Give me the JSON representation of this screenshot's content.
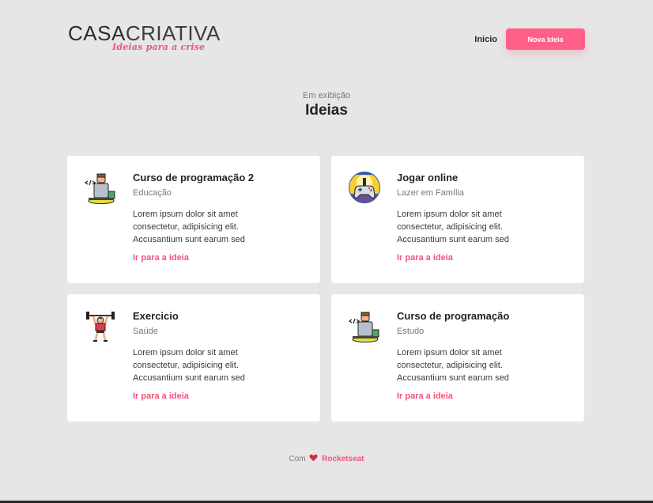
{
  "logo": {
    "part1": "CASA",
    "part2": "CRIATIVA",
    "tagline": "Ideias para a crise"
  },
  "nav": {
    "home_label": "Inicio",
    "new_idea_label": "Nova Ideia"
  },
  "section": {
    "subtitle": "Em exibição",
    "title": "Ideias"
  },
  "cards": [
    {
      "icon": "programmer-icon",
      "title": "Curso de programação 2",
      "category": "Educação",
      "description": "Lorem ipsum dolor sit amet consectetur, adipisicing elit. Accusantium sunt earum sed",
      "link": "Ir para a ideia"
    },
    {
      "icon": "gamepad-icon",
      "title": "Jogar online",
      "category": "Lazer em Família",
      "description": "Lorem ipsum dolor sit amet consectetur, adipisicing elit. Accusantium sunt earum sed",
      "link": "Ir para a ideia"
    },
    {
      "icon": "weightlifter-icon",
      "title": "Exercicio",
      "category": "Saúde",
      "description": "Lorem ipsum dolor sit amet consectetur, adipisicing elit. Accusantium sunt earum sed",
      "link": "Ir para a ideia"
    },
    {
      "icon": "programmer-icon",
      "title": "Curso de programação",
      "category": "Estudo",
      "description": "Lorem ipsum dolor sit amet consectetur, adipisicing elit. Accusantium sunt earum sed",
      "link": "Ir para a ideia"
    }
  ],
  "footer": {
    "prefix": "Com",
    "icon": "heart-icon",
    "brand": "Rocketseat"
  },
  "colors": {
    "accent": "#ff5f89",
    "background": "#e6e6e6",
    "card": "#ffffff"
  }
}
